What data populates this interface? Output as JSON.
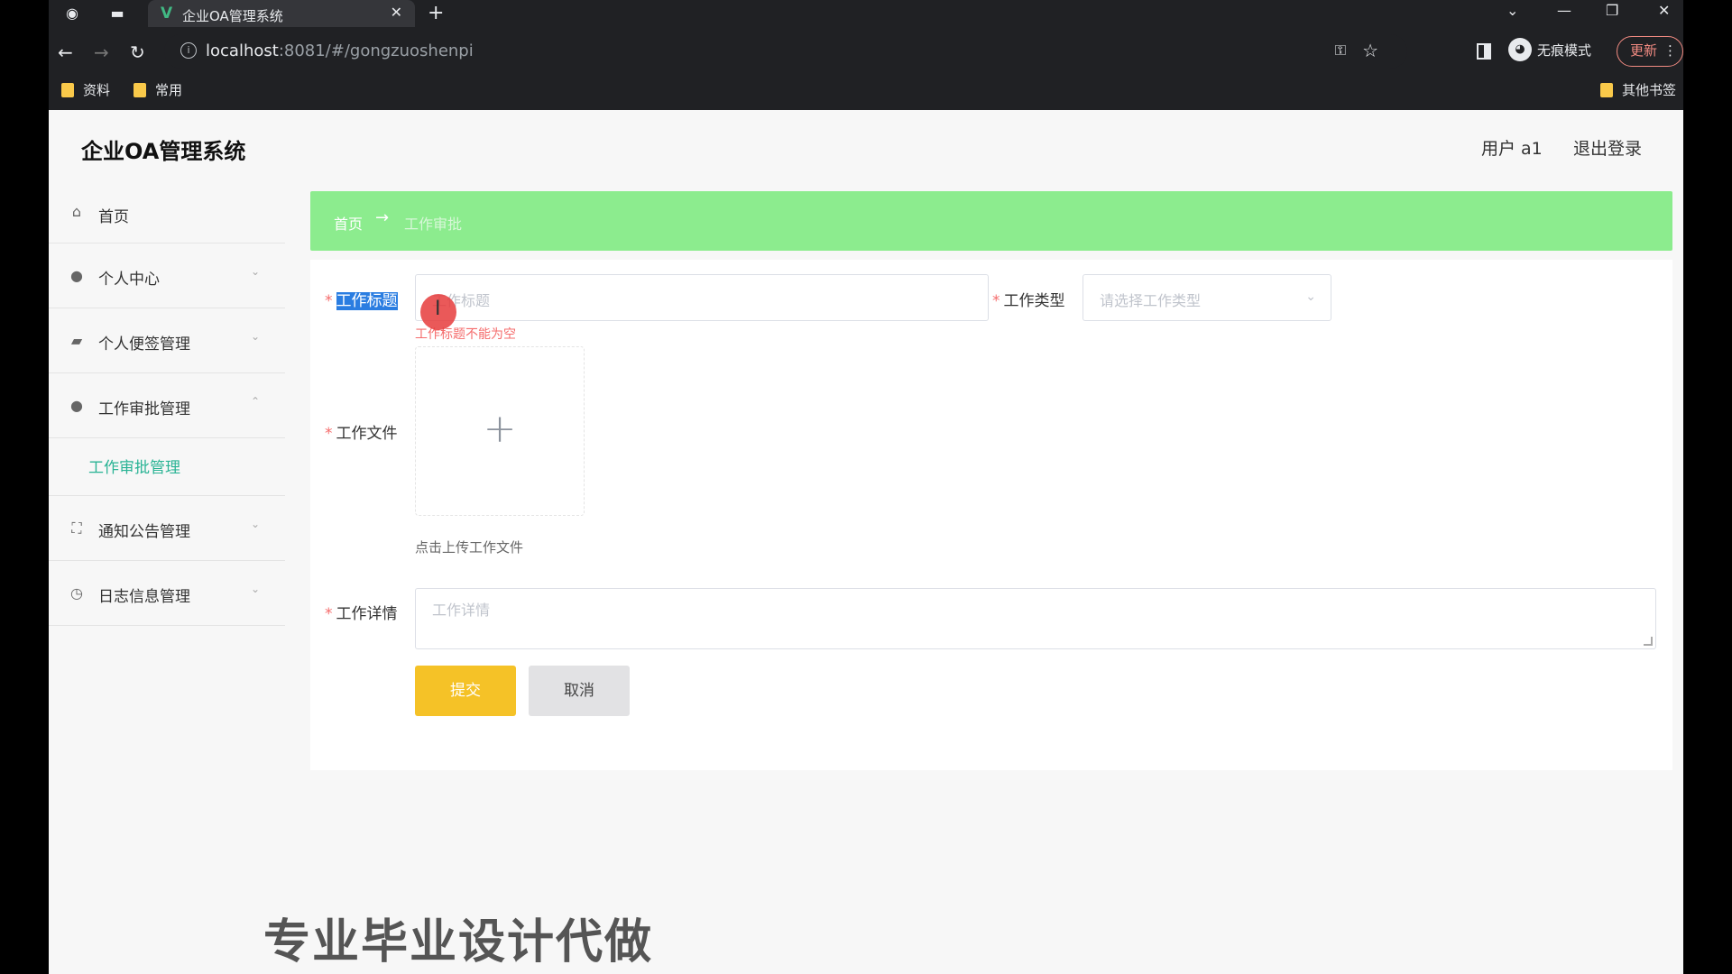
{
  "browser": {
    "tab_title": "企业OA管理系统",
    "tab_logo": "V",
    "url_host": "localhost",
    "url_rest": ":8081/#/gongzuoshenpi",
    "incognito_label": "无痕模式",
    "update_label": "更新",
    "bookmarks": [
      "资料",
      "常用"
    ],
    "other_bookmarks": "其他书签"
  },
  "header": {
    "title": "企业OA管理系统",
    "user_label": "用户 a1",
    "logout_label": "退出登录"
  },
  "sidebar": {
    "items": [
      {
        "label": "首页",
        "icon": "home-icon"
      },
      {
        "label": "个人中心",
        "icon": "user-icon"
      },
      {
        "label": "个人便签管理",
        "icon": "briefcase-icon"
      },
      {
        "label": "工作审批管理",
        "icon": "user-icon"
      },
      {
        "label": "通知公告管理",
        "icon": "expand-icon"
      },
      {
        "label": "日志信息管理",
        "icon": "clock-icon"
      }
    ],
    "submenu": {
      "label": "工作审批管理"
    }
  },
  "breadcrumb": {
    "home": "首页",
    "separator": "→",
    "current": "工作审批"
  },
  "form": {
    "title_label": "工作标题",
    "title_placeholder": "工作标题",
    "title_error": "工作标题不能为空",
    "type_label": "工作类型",
    "type_placeholder": "请选择工作类型",
    "file_label": "工作文件",
    "file_hint": "点击上传工作文件",
    "detail_label": "工作详情",
    "detail_placeholder": "工作详情",
    "submit_label": "提交",
    "cancel_label": "取消",
    "required_mark": "*"
  },
  "overlay": {
    "watermark": "专业毕业设计代做",
    "cursor_glyph": "I"
  },
  "colors": {
    "breadcrumb_bg": "#8cec8e",
    "submit_bg": "#f5c227",
    "accent_text": "#29b394",
    "error": "#f56c6c"
  }
}
